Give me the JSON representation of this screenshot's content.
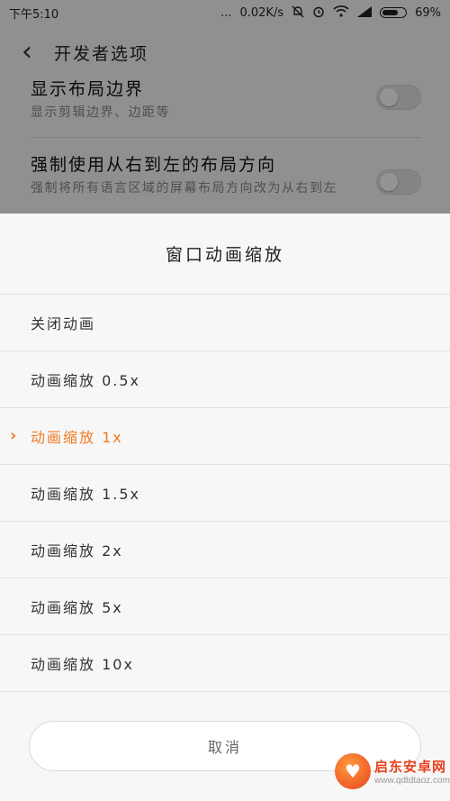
{
  "status_bar": {
    "time": "下午5:10",
    "dots": "...",
    "network_speed": "0.02K/s",
    "battery_percent": "69%",
    "battery_level": 0.69,
    "icons": [
      "mute-bell-icon",
      "alarm-icon",
      "wifi-icon",
      "signal-icon",
      "battery-icon"
    ]
  },
  "app_bar": {
    "title": "开发者选项"
  },
  "settings": [
    {
      "title": "显示布局边界",
      "desc": "显示剪辑边界、边距等",
      "enabled": false
    },
    {
      "title": "强制使用从右到左的布局方向",
      "desc": "强制将所有语言区域的屏幕布局方向改为从右到左",
      "enabled": false
    }
  ],
  "dialog": {
    "title": "窗口动画缩放",
    "options": [
      {
        "label": "关闭动画",
        "selected": false
      },
      {
        "label": "动画缩放 0.5x",
        "selected": false
      },
      {
        "label": "动画缩放 1x",
        "selected": true
      },
      {
        "label": "动画缩放 1.5x",
        "selected": false
      },
      {
        "label": "动画缩放 2x",
        "selected": false
      },
      {
        "label": "动画缩放 5x",
        "selected": false
      },
      {
        "label": "动画缩放 10x",
        "selected": false
      }
    ],
    "cancel_label": "取消"
  },
  "watermark": {
    "name": "启东安卓网",
    "url": "www.qdtdtaoz.com"
  },
  "colors": {
    "accent": "#f07a23",
    "overlay": "rgba(0,0,0,0.42)"
  }
}
